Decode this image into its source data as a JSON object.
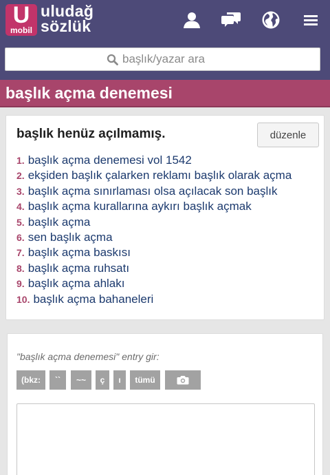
{
  "header": {
    "logo_letter": "U",
    "logo_sub": "mobil",
    "logo_line1": "uludağ",
    "logo_line2": "sözlük",
    "icons": [
      "user-icon",
      "chat-icon",
      "globe-icon",
      "menu-icon"
    ]
  },
  "search": {
    "placeholder": "başlık/yazar ara"
  },
  "topic": {
    "title": "başlık açma denemesi",
    "status": "başlık henüz açılmamış.",
    "edit_label": "düzenle"
  },
  "suggestions": [
    {
      "num": "1.",
      "text": "başlık açma denemesi vol 1542"
    },
    {
      "num": "2.",
      "text": "ekşiden başlık çalarken reklamı başlık olarak açma"
    },
    {
      "num": "3.",
      "text": "başlık açma sınırlaması olsa açılacak son başlık"
    },
    {
      "num": "4.",
      "text": "başlık açma kurallarına aykırı başlık açmak"
    },
    {
      "num": "5.",
      "text": "başlık açma"
    },
    {
      "num": "6.",
      "text": "sen başlık açma"
    },
    {
      "num": "7.",
      "text": "başlık açma baskısı"
    },
    {
      "num": "8.",
      "text": "başlık açma ruhsatı"
    },
    {
      "num": "9.",
      "text": "başlık açma ahlakı"
    },
    {
      "num": "10.",
      "text": "başlık açma bahaneleri"
    }
  ],
  "entry": {
    "prompt": "\"başlık açma denemesi\" entry gir:",
    "toolbar": {
      "bkz": "(bkz:",
      "backtick": "``",
      "tilde": "~~",
      "c_cedilla": "ç",
      "dotless_i": "ı",
      "all": "tümü",
      "camera_icon": "camera-icon"
    }
  },
  "colors": {
    "header_bg": "#4d4a78",
    "accent": "#a8456b",
    "logo_bg": "#c2346a",
    "link": "#1c3a6e",
    "toolbar_btn": "#a2a2a2"
  }
}
